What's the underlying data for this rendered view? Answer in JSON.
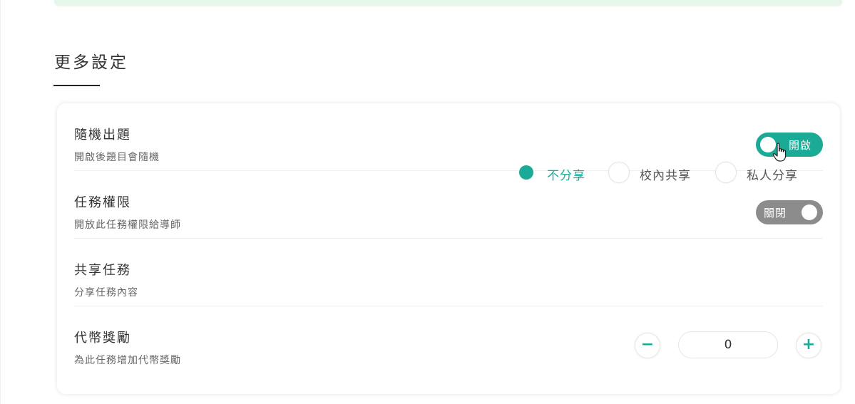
{
  "section": {
    "title": "更多設定"
  },
  "settings": {
    "random_questions": {
      "title": "隨機出題",
      "description": "開啟後題目會隨機",
      "toggle_label": "開啟",
      "state": "on"
    },
    "task_permission": {
      "title": "任務權限",
      "description": "開放此任務權限給導師",
      "toggle_label": "關閉",
      "state": "off"
    },
    "share_task": {
      "title": "共享任務",
      "description": "分享任務內容",
      "options": [
        {
          "label": "不分享",
          "checked": true
        },
        {
          "label": "校內共享",
          "checked": false
        },
        {
          "label": "私人分享",
          "checked": false
        }
      ]
    },
    "coin_reward": {
      "title": "代幣獎勵",
      "description": "為此任務增加代幣獎勵",
      "value": "0",
      "minus": "−",
      "plus": "+"
    }
  },
  "colors": {
    "accent": "#1aaa96",
    "toggle_off": "#8c8c8c"
  },
  "icons": {
    "cursor": "hand-pointer-icon"
  }
}
